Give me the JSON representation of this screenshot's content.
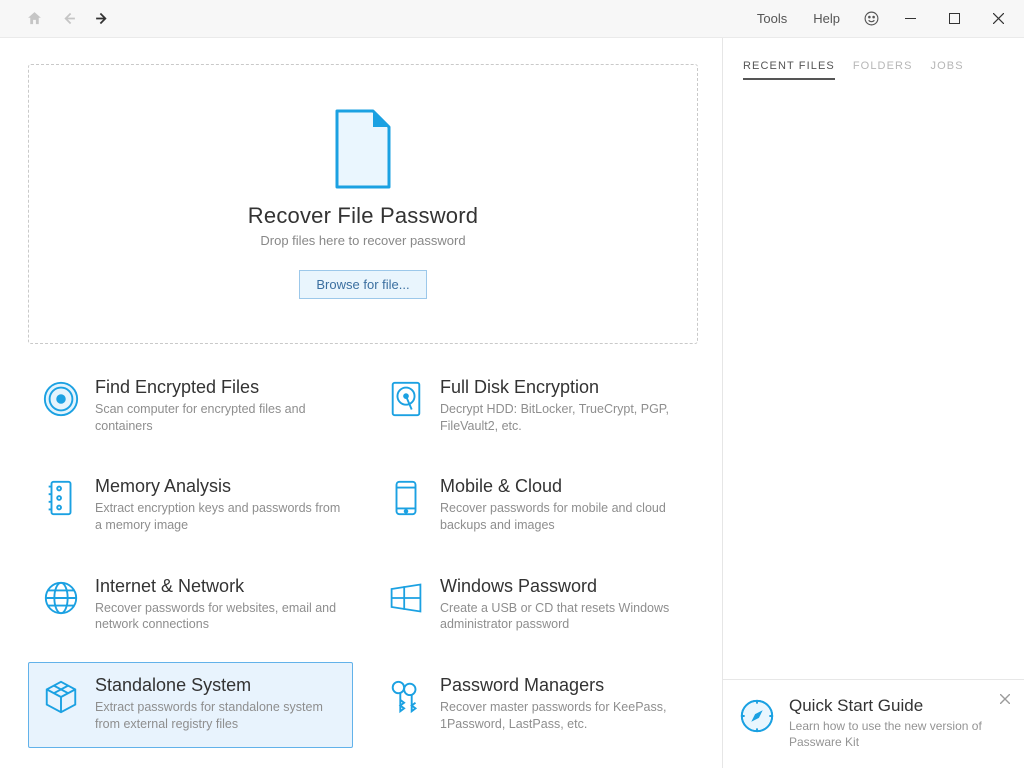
{
  "menu": {
    "tools": "Tools",
    "help": "Help"
  },
  "dropzone": {
    "title": "Recover File Password",
    "subtitle": "Drop files here to recover password",
    "browse": "Browse for file..."
  },
  "tiles": [
    {
      "title": "Find Encrypted Files",
      "desc": "Scan computer for encrypted files and containers"
    },
    {
      "title": "Full Disk Encryption",
      "desc": "Decrypt HDD: BitLocker, TrueCrypt, PGP, FileVault2, etc."
    },
    {
      "title": "Memory Analysis",
      "desc": "Extract encryption keys and passwords from a memory image"
    },
    {
      "title": "Mobile & Cloud",
      "desc": "Recover passwords for mobile and cloud backups and images"
    },
    {
      "title": "Internet & Network",
      "desc": "Recover passwords for websites, email and network connections"
    },
    {
      "title": "Windows Password",
      "desc": "Create a USB or CD that resets Windows administrator password"
    },
    {
      "title": "Standalone System",
      "desc": "Extract passwords for standalone system from external registry files"
    },
    {
      "title": "Password Managers",
      "desc": "Recover master passwords for KeePass, 1Password, LastPass, etc."
    }
  ],
  "side_tabs": {
    "recent": "RECENT FILES",
    "folders": "FOLDERS",
    "jobs": "JOBS"
  },
  "guide": {
    "title": "Quick Start Guide",
    "desc": "Learn how to use the new version of Passware Kit"
  }
}
